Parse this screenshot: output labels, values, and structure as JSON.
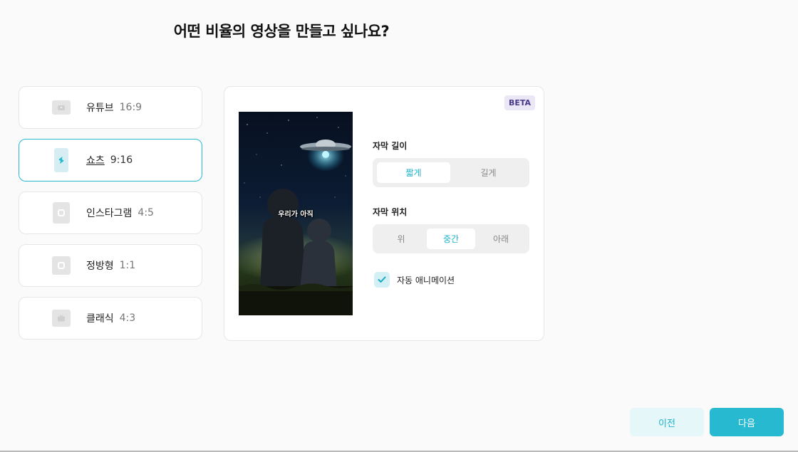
{
  "page": {
    "title": "어떤 비율의 영상을 만들고 싶나요?"
  },
  "ratios": [
    {
      "name": "유튜브",
      "value": "16:9",
      "icon": "youtube-icon",
      "selected": false
    },
    {
      "name": "쇼츠",
      "value": "9:16",
      "icon": "shorts-icon",
      "selected": true
    },
    {
      "name": "인스타그램",
      "value": "4:5",
      "icon": "instagram-icon",
      "selected": false
    },
    {
      "name": "정방형",
      "value": "1:1",
      "icon": "square-icon",
      "selected": false
    },
    {
      "name": "클래식",
      "value": "4:3",
      "icon": "tv-icon",
      "selected": false
    }
  ],
  "panel": {
    "badge": "BETA",
    "preview_caption": "우리가 아직",
    "subtitle_length": {
      "label": "자막 길이",
      "options": [
        "짧게",
        "길게"
      ],
      "selected": "짧게"
    },
    "subtitle_position": {
      "label": "자막 위치",
      "options": [
        "위",
        "중간",
        "아래"
      ],
      "selected": "중간"
    },
    "auto_animation": {
      "label": "자동 애니메이션",
      "checked": true
    }
  },
  "footer": {
    "prev_label": "이전",
    "next_label": "다음"
  },
  "colors": {
    "accent": "#26b9d0",
    "accent_light": "#e6f7fa",
    "beta_bg": "#ece7f7",
    "beta_text": "#4a3a8c"
  }
}
